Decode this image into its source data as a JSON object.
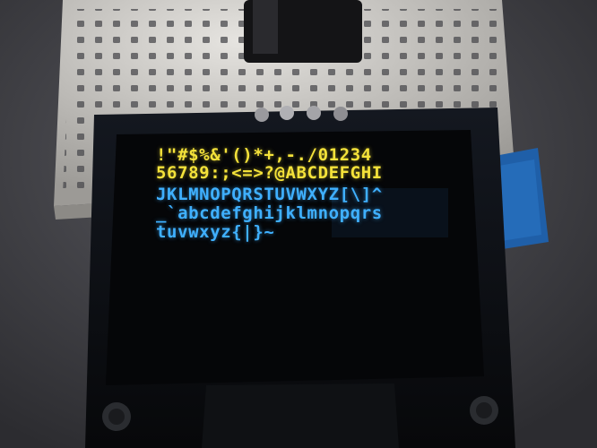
{
  "display": {
    "lines": [
      {
        "text": "!\"#$%&'()*+,-./01234",
        "color": "#f4e23a"
      },
      {
        "text": "56789:;<=>?@ABCDEFGHI",
        "color": "#f4e23a"
      },
      {
        "text": "JKLMNOPQRSTUVWXYZ[\\]^",
        "color": "#3fb0ff"
      },
      {
        "text": "_`abcdefghijklmnopqrs",
        "color": "#3fb0ff"
      },
      {
        "text": "tuvwxyz{|}~",
        "color": "#3fb0ff"
      }
    ]
  },
  "colors": {
    "yellow_zone": "#f4e23a",
    "blue_zone": "#3fb0ff",
    "panel": "#050608",
    "pcb": "#0b0d10",
    "breadboard": "#d8d6d2"
  }
}
